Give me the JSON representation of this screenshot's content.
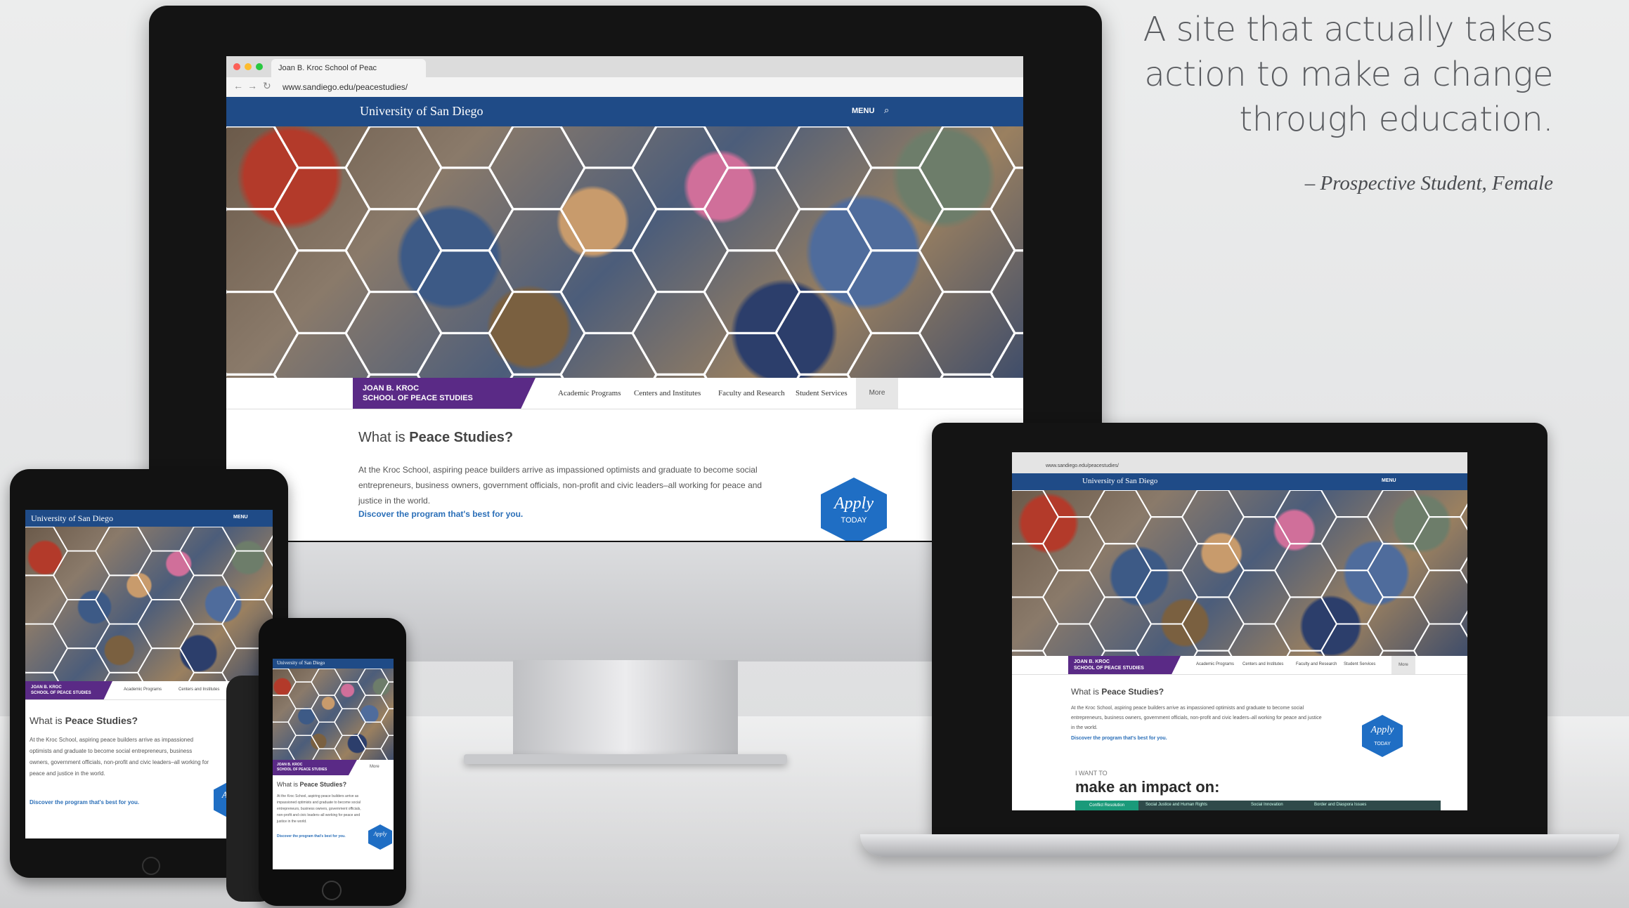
{
  "quote": {
    "lines": [
      "A site that actually takes",
      "action to make a change",
      "through education."
    ],
    "attribution": "– Prospective Student, Female"
  },
  "browser": {
    "tab_title": "Joan B. Kroc School of Peac",
    "url": "www.sandiego.edu/peacestudies/"
  },
  "site": {
    "logo": "University of San Diego",
    "menu_label": "MENU",
    "school_name_line1": "JOAN B. KROC",
    "school_name_line2": "SCHOOL of PEACE STUDIES",
    "subnav": [
      "Academic Programs",
      "Centers and Institutes",
      "Faculty and Research",
      "Student Services",
      "More"
    ],
    "heading_prefix": "What is",
    "heading_bold": "Peace Studies?",
    "body": "At the Kroc School, aspiring peace builders arrive as impassioned optimists and graduate to become social entrepreneurs, business owners, government officials, non-profit and civic leaders–all working for peace and justice in the world.",
    "cta_link": "Discover the program that's best for you.",
    "apply_label": "Apply",
    "apply_sub": "TODAY",
    "impact_kicker": "I WANT TO",
    "impact_heading": "make an impact on:",
    "impact_tabs": [
      "Conflict Resolution",
      "Social Justice and Human Rights",
      "Social Innovation",
      "Border and Diaspora Issues"
    ]
  },
  "colors": {
    "navy": "#1f4b87",
    "purple": "#5a2a86",
    "accent_blue": "#1f6ec4",
    "impact_green": "#1a9a7a"
  }
}
